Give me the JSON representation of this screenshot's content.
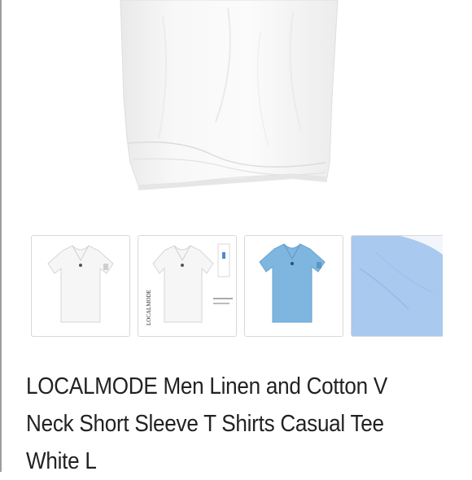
{
  "product": {
    "title": "LOCALMODE Men Linen and Cotton V Neck Short Sleeve T Shirts Casual Tee White L"
  },
  "gallery": {
    "thumbnails": [
      {
        "alt": "white-shirt-front",
        "color": "#ffffff"
      },
      {
        "alt": "white-shirt-with-tag",
        "color": "#ffffff",
        "tag_text": "LOCALMODE"
      },
      {
        "alt": "blue-shirt-front",
        "color": "#7fb6e0"
      },
      {
        "alt": "blue-fabric-closeup",
        "color": "#a9c9ef"
      }
    ]
  },
  "colors": {
    "title_text": "#222222",
    "thumb_border": "#d8d8d8",
    "shirt_white": "#f4f4f4",
    "shirt_blue": "#7fb6e0",
    "fabric_blue": "#a9c9ef"
  }
}
